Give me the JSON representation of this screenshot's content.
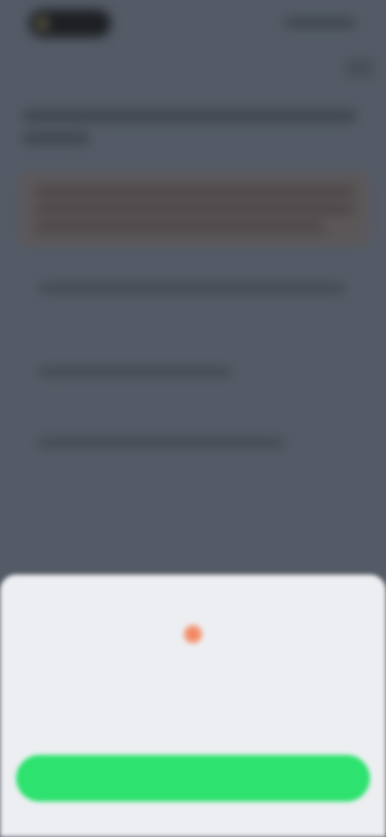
{
  "dialog": {
    "icon": "warning-icon",
    "title": "",
    "message": "",
    "button_label": ""
  },
  "colors": {
    "backdrop": "#545b66",
    "sheet_background": "#eceef1",
    "button_green": "#2ee26f",
    "icon_orange": "#f0764c"
  }
}
